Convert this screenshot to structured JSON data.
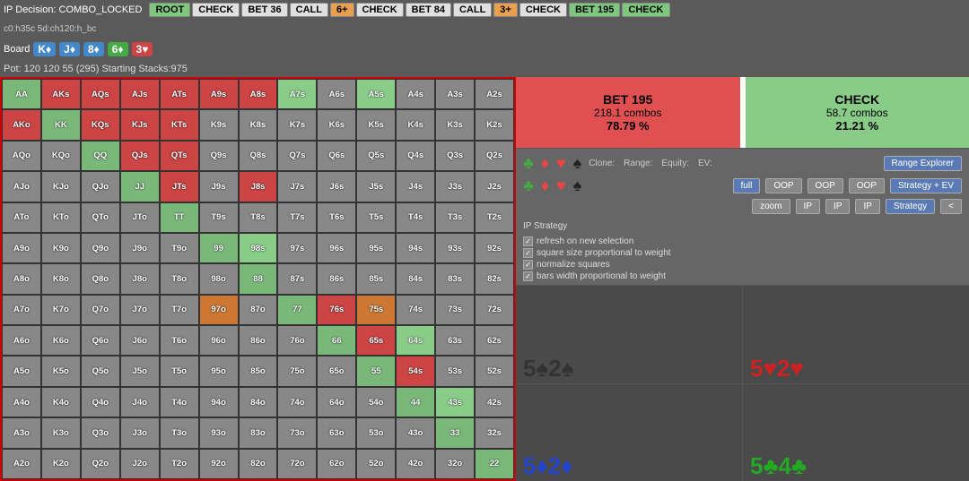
{
  "top_bar": {
    "ip_decision": "IP Decision: COMBO_LOCKED",
    "path": "c0:h35c 5d:ch120:h_bc",
    "buttons": [
      {
        "label": "ROOT",
        "style": "green"
      },
      {
        "label": "CHECK",
        "style": "white"
      },
      {
        "label": "BET 36",
        "style": "white"
      },
      {
        "label": "CALL",
        "style": "white"
      },
      {
        "label": "6+",
        "style": "orange"
      },
      {
        "label": "CHECK",
        "style": "white"
      },
      {
        "label": "BET 84",
        "style": "white"
      },
      {
        "label": "CALL",
        "style": "white"
      },
      {
        "label": "3+",
        "style": "orange"
      },
      {
        "label": "CHECK",
        "style": "white"
      },
      {
        "label": "BET 195",
        "style": "green"
      },
      {
        "label": "CHECK",
        "style": "green"
      }
    ]
  },
  "board": {
    "label": "Board",
    "cards": [
      "K♦",
      "J♦",
      "8♦",
      "6♦",
      "3♥"
    ]
  },
  "pot": "Pot: 120 120 55 (295) Starting Stacks:975",
  "action_boxes": {
    "bet": {
      "title": "BET 195",
      "combos": "218.1 combos",
      "pct": "78.79 %"
    },
    "check": {
      "title": "CHECK",
      "combos": "58.7 combos",
      "pct": "21.21 %"
    }
  },
  "controls": {
    "clone_label": "Clone:",
    "range_label": "Range:",
    "equity_label": "Equity:",
    "ev_label": "EV:",
    "full_btn": "full",
    "zoom_btn": "zoom",
    "oop_btn": "OOP",
    "ip_btn": "IP",
    "strategy_ev_btn": "Strategy + EV",
    "strategy_btn": "Strategy",
    "range_explorer_btn": "Range Explorer",
    "arrow_btn": "<",
    "ip_strategy": "IP Strategy"
  },
  "options": [
    "refresh on new selection",
    "square size proportional to weight",
    "normalize squares",
    "bars width proportional to weight"
  ],
  "board_cards": [
    {
      "rank": "5",
      "suit": "♠",
      "suit2": "2",
      "suit3": "♠",
      "color": "black",
      "label": "5♠2♠"
    },
    {
      "rank": "5",
      "suit": "♥",
      "suit2": "2",
      "suit3": "♥",
      "color": "red",
      "label": "5♥2♥"
    },
    {
      "rank": "5",
      "suit": "♦",
      "suit2": "2",
      "suit3": "♦",
      "color": "blue",
      "label": "5♦2♦"
    },
    {
      "rank": "5",
      "suit": "♣",
      "suit2": "4",
      "suit3": "♣",
      "color": "green",
      "label": "5♣4♣"
    }
  ],
  "matrix": {
    "headers": [
      "AA",
      "AKs",
      "AQs",
      "AJs",
      "ATs",
      "A9s",
      "A8s",
      "A7s",
      "A6s",
      "A5s",
      "A4s",
      "A3s",
      "A2s"
    ],
    "rows": [
      {
        "cells": [
          "AA",
          "AKs",
          "AQs",
          "AJs",
          "ATs",
          "A9s",
          "A8s",
          "A7s",
          "A6s",
          "A5s",
          "A4s",
          "A3s",
          "A2s"
        ],
        "styles": [
          "c-pair",
          "c-red",
          "c-red",
          "c-red",
          "c-red",
          "c-red",
          "c-red",
          "c-light-green",
          "c-offsuit",
          "c-light-green",
          "c-offsuit",
          "c-offsuit",
          "c-offsuit"
        ]
      },
      {
        "cells": [
          "AKo",
          "KK",
          "KQs",
          "KJs",
          "KTs",
          "K9s",
          "K8s",
          "K7s",
          "K6s",
          "K5s",
          "K4s",
          "K3s",
          "K2s"
        ],
        "styles": [
          "c-red",
          "c-pair",
          "c-red",
          "c-red",
          "c-red",
          "c-offsuit",
          "c-offsuit",
          "c-offsuit",
          "c-offsuit",
          "c-offsuit",
          "c-offsuit",
          "c-offsuit",
          "c-offsuit"
        ]
      },
      {
        "cells": [
          "AQo",
          "KQo",
          "QQ",
          "QJs",
          "QTs",
          "Q9s",
          "Q8s",
          "Q7s",
          "Q6s",
          "Q5s",
          "Q4s",
          "Q3s",
          "Q2s"
        ],
        "styles": [
          "c-offsuit",
          "c-offsuit",
          "c-pair",
          "c-red",
          "c-red",
          "c-offsuit",
          "c-offsuit",
          "c-offsuit",
          "c-offsuit",
          "c-offsuit",
          "c-offsuit",
          "c-offsuit",
          "c-offsuit"
        ]
      },
      {
        "cells": [
          "AJo",
          "KJo",
          "QJo",
          "JJ",
          "JTs",
          "J9s",
          "J8s",
          "J7s",
          "J6s",
          "J5s",
          "J4s",
          "J3s",
          "J2s"
        ],
        "styles": [
          "c-offsuit",
          "c-offsuit",
          "c-offsuit",
          "c-pair",
          "c-red",
          "c-offsuit",
          "c-red",
          "c-offsuit",
          "c-offsuit",
          "c-offsuit",
          "c-offsuit",
          "c-offsuit",
          "c-offsuit"
        ]
      },
      {
        "cells": [
          "ATo",
          "KTo",
          "QTo",
          "JTo",
          "TT",
          "T9s",
          "T8s",
          "T7s",
          "T6s",
          "T5s",
          "T4s",
          "T3s",
          "T2s"
        ],
        "styles": [
          "c-offsuit",
          "c-offsuit",
          "c-offsuit",
          "c-offsuit",
          "c-pair",
          "c-offsuit",
          "c-offsuit",
          "c-offsuit",
          "c-offsuit",
          "c-offsuit",
          "c-offsuit",
          "c-offsuit",
          "c-offsuit"
        ]
      },
      {
        "cells": [
          "A9o",
          "K9o",
          "Q9o",
          "J9o",
          "T9o",
          "99",
          "98s",
          "97s",
          "96s",
          "95s",
          "94s",
          "93s",
          "92s"
        ],
        "styles": [
          "c-offsuit",
          "c-offsuit",
          "c-offsuit",
          "c-offsuit",
          "c-offsuit",
          "c-pair",
          "c-light-green",
          "c-offsuit",
          "c-offsuit",
          "c-offsuit",
          "c-offsuit",
          "c-offsuit",
          "c-offsuit"
        ]
      },
      {
        "cells": [
          "A8o",
          "K8o",
          "Q8o",
          "J8o",
          "T8o",
          "98o",
          "88",
          "87s",
          "86s",
          "85s",
          "84s",
          "83s",
          "82s"
        ],
        "styles": [
          "c-offsuit",
          "c-offsuit",
          "c-offsuit",
          "c-offsuit",
          "c-offsuit",
          "c-offsuit",
          "c-pair",
          "c-offsuit",
          "c-offsuit",
          "c-offsuit",
          "c-offsuit",
          "c-offsuit",
          "c-offsuit"
        ]
      },
      {
        "cells": [
          "A7o",
          "K7o",
          "Q7o",
          "J7o",
          "T7o",
          "97o",
          "87o",
          "77",
          "76s",
          "75s",
          "74s",
          "73s",
          "72s"
        ],
        "styles": [
          "c-offsuit",
          "c-offsuit",
          "c-offsuit",
          "c-offsuit",
          "c-offsuit",
          "c-orange",
          "c-offsuit",
          "c-pair",
          "c-red",
          "c-orange",
          "c-offsuit",
          "c-offsuit",
          "c-offsuit"
        ]
      },
      {
        "cells": [
          "A6o",
          "K6o",
          "Q6o",
          "J6o",
          "T6o",
          "96o",
          "86o",
          "76o",
          "66",
          "65s",
          "64s",
          "63s",
          "62s"
        ],
        "styles": [
          "c-offsuit",
          "c-offsuit",
          "c-offsuit",
          "c-offsuit",
          "c-offsuit",
          "c-offsuit",
          "c-offsuit",
          "c-offsuit",
          "c-pair",
          "c-red",
          "c-light-green",
          "c-offsuit",
          "c-offsuit"
        ]
      },
      {
        "cells": [
          "A5o",
          "K5o",
          "Q5o",
          "J5o",
          "T5o",
          "95o",
          "85o",
          "75o",
          "65o",
          "55",
          "54s",
          "53s",
          "52s"
        ],
        "styles": [
          "c-offsuit",
          "c-offsuit",
          "c-offsuit",
          "c-offsuit",
          "c-offsuit",
          "c-offsuit",
          "c-offsuit",
          "c-offsuit",
          "c-offsuit",
          "c-pair",
          "c-red",
          "c-offsuit",
          "c-offsuit"
        ]
      },
      {
        "cells": [
          "A4o",
          "K4o",
          "Q4o",
          "J4o",
          "T4o",
          "94o",
          "84o",
          "74o",
          "64o",
          "54o",
          "44",
          "43s",
          "42s"
        ],
        "styles": [
          "c-offsuit",
          "c-offsuit",
          "c-offsuit",
          "c-offsuit",
          "c-offsuit",
          "c-offsuit",
          "c-offsuit",
          "c-offsuit",
          "c-offsuit",
          "c-offsuit",
          "c-pair",
          "c-light-green",
          "c-offsuit"
        ]
      },
      {
        "cells": [
          "A3o",
          "K3o",
          "Q3o",
          "J3o",
          "T3o",
          "93o",
          "83o",
          "73o",
          "63o",
          "53o",
          "43o",
          "33",
          "32s"
        ],
        "styles": [
          "c-offsuit",
          "c-offsuit",
          "c-offsuit",
          "c-offsuit",
          "c-offsuit",
          "c-offsuit",
          "c-offsuit",
          "c-offsuit",
          "c-offsuit",
          "c-offsuit",
          "c-offsuit",
          "c-pair",
          "c-offsuit"
        ]
      },
      {
        "cells": [
          "A2o",
          "K2o",
          "Q2o",
          "J2o",
          "T2o",
          "92o",
          "82o",
          "72o",
          "62o",
          "52o",
          "42o",
          "32o",
          "22"
        ],
        "styles": [
          "c-offsuit",
          "c-offsuit",
          "c-offsuit",
          "c-offsuit",
          "c-offsuit",
          "c-offsuit",
          "c-offsuit",
          "c-offsuit",
          "c-offsuit",
          "c-offsuit",
          "c-offsuit",
          "c-offsuit",
          "c-pair"
        ]
      }
    ]
  }
}
